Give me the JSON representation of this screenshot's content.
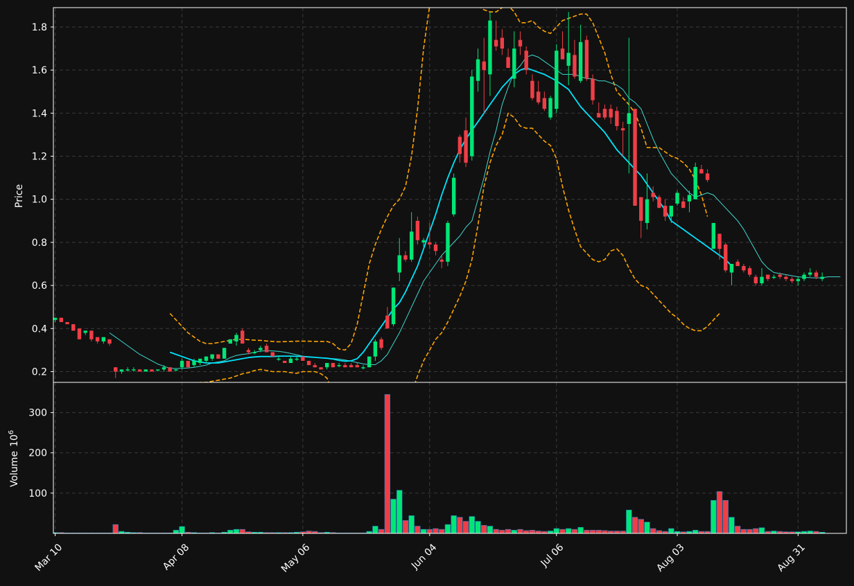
{
  "chart_data": {
    "type": "candlestick",
    "price_axis": {
      "label": "Price",
      "ticks": [
        0.2,
        0.4,
        0.6,
        0.8,
        1.0,
        1.2,
        1.4,
        1.6,
        1.8
      ],
      "ylim": [
        0.15,
        1.89
      ]
    },
    "volume_axis": {
      "label": "Volume",
      "exponent_label": "10",
      "exponent": "6",
      "ticks": [
        100,
        200,
        300
      ],
      "ylim": [
        0,
        375
      ]
    },
    "x_axis": {
      "ticks": [
        {
          "label": "Mar 10",
          "index": 0
        },
        {
          "label": "Apr 08",
          "index": 21
        },
        {
          "label": "May 06",
          "index": 41
        },
        {
          "label": "Jun 04",
          "index": 62
        },
        {
          "label": "Jul 06",
          "index": 83
        },
        {
          "label": "Aug 03",
          "index": 103
        },
        {
          "label": "Aug 31",
          "index": 123
        }
      ],
      "index_range": [
        -0.3,
        131
      ]
    },
    "grid": true,
    "colors": {
      "background": "#111111",
      "up": "#00e676",
      "down": "#ef3e47",
      "ma_fast": "#40d9d0",
      "ma_slow": "#00e5ff",
      "bands": "#ffa500",
      "grid": "#3a3a3a",
      "text": "#ffffff"
    },
    "candles": [
      [
        0.44,
        0.45,
        0.43,
        0.45,
        2
      ],
      [
        0.45,
        0.45,
        0.43,
        0.43,
        2
      ],
      [
        0.43,
        0.43,
        0.42,
        0.42,
        1
      ],
      [
        0.42,
        0.42,
        0.39,
        0.39,
        1
      ],
      [
        0.4,
        0.4,
        0.35,
        0.35,
        1
      ],
      [
        0.38,
        0.39,
        0.37,
        0.39,
        1
      ],
      [
        0.39,
        0.39,
        0.34,
        0.35,
        1
      ],
      [
        0.36,
        0.36,
        0.33,
        0.34,
        1
      ],
      [
        0.34,
        0.36,
        0.33,
        0.36,
        1
      ],
      [
        0.35,
        0.35,
        0.32,
        0.33,
        1
      ],
      [
        0.22,
        0.22,
        0.17,
        0.2,
        22
      ],
      [
        0.2,
        0.21,
        0.19,
        0.21,
        5
      ],
      [
        0.21,
        0.22,
        0.2,
        0.21,
        3
      ],
      [
        0.21,
        0.22,
        0.2,
        0.21,
        2
      ],
      [
        0.21,
        0.21,
        0.2,
        0.2,
        2
      ],
      [
        0.2,
        0.21,
        0.2,
        0.21,
        1
      ],
      [
        0.21,
        0.21,
        0.2,
        0.2,
        1
      ],
      [
        0.21,
        0.21,
        0.2,
        0.21,
        1
      ],
      [
        0.21,
        0.23,
        0.2,
        0.22,
        1
      ],
      [
        0.22,
        0.22,
        0.2,
        0.2,
        1
      ],
      [
        0.21,
        0.21,
        0.2,
        0.21,
        8
      ],
      [
        0.22,
        0.26,
        0.21,
        0.25,
        17
      ],
      [
        0.25,
        0.25,
        0.22,
        0.22,
        3
      ],
      [
        0.23,
        0.26,
        0.22,
        0.25,
        2
      ],
      [
        0.24,
        0.26,
        0.23,
        0.26,
        1
      ],
      [
        0.25,
        0.27,
        0.24,
        0.27,
        1
      ],
      [
        0.26,
        0.28,
        0.25,
        0.28,
        2
      ],
      [
        0.28,
        0.28,
        0.26,
        0.26,
        1
      ],
      [
        0.26,
        0.31,
        0.26,
        0.31,
        3
      ],
      [
        0.33,
        0.35,
        0.33,
        0.35,
        8
      ],
      [
        0.34,
        0.38,
        0.32,
        0.37,
        10
      ],
      [
        0.39,
        0.4,
        0.33,
        0.33,
        10
      ],
      [
        0.3,
        0.31,
        0.28,
        0.29,
        4
      ],
      [
        0.29,
        0.3,
        0.28,
        0.29,
        3
      ],
      [
        0.3,
        0.32,
        0.29,
        0.31,
        3
      ],
      [
        0.32,
        0.33,
        0.29,
        0.29,
        2
      ],
      [
        0.29,
        0.29,
        0.27,
        0.27,
        2
      ],
      [
        0.26,
        0.27,
        0.25,
        0.26,
        2
      ],
      [
        0.25,
        0.25,
        0.24,
        0.24,
        2
      ],
      [
        0.24,
        0.27,
        0.24,
        0.26,
        2
      ],
      [
        0.26,
        0.27,
        0.25,
        0.26,
        3
      ],
      [
        0.27,
        0.27,
        0.25,
        0.25,
        4
      ],
      [
        0.25,
        0.25,
        0.23,
        0.23,
        6
      ],
      [
        0.23,
        0.24,
        0.22,
        0.22,
        5
      ],
      [
        0.22,
        0.22,
        0.21,
        0.21,
        2
      ],
      [
        0.22,
        0.24,
        0.21,
        0.24,
        3
      ],
      [
        0.24,
        0.24,
        0.22,
        0.22,
        2
      ],
      [
        0.23,
        0.24,
        0.22,
        0.23,
        1
      ],
      [
        0.23,
        0.24,
        0.22,
        0.22,
        1
      ],
      [
        0.23,
        0.24,
        0.22,
        0.22,
        1
      ],
      [
        0.23,
        0.24,
        0.22,
        0.22,
        1
      ],
      [
        0.22,
        0.23,
        0.21,
        0.22,
        1
      ],
      [
        0.22,
        0.27,
        0.22,
        0.27,
        5
      ],
      [
        0.27,
        0.35,
        0.25,
        0.34,
        18
      ],
      [
        0.35,
        0.36,
        0.3,
        0.31,
        10
      ],
      [
        0.46,
        0.5,
        0.4,
        0.4,
        345
      ],
      [
        0.42,
        0.59,
        0.41,
        0.59,
        85
      ],
      [
        0.66,
        0.82,
        0.62,
        0.74,
        107
      ],
      [
        0.74,
        0.76,
        0.71,
        0.72,
        32
      ],
      [
        0.72,
        0.94,
        0.71,
        0.85,
        44
      ],
      [
        0.9,
        0.92,
        0.79,
        0.81,
        18
      ],
      [
        0.8,
        0.82,
        0.78,
        0.81,
        10
      ],
      [
        0.8,
        0.89,
        0.77,
        0.79,
        10
      ],
      [
        0.79,
        0.8,
        0.74,
        0.76,
        12
      ],
      [
        0.72,
        0.74,
        0.68,
        0.71,
        10
      ],
      [
        0.71,
        0.9,
        0.69,
        0.89,
        22
      ],
      [
        0.93,
        1.12,
        0.92,
        1.1,
        44
      ],
      [
        1.29,
        1.3,
        1.17,
        1.21,
        40
      ],
      [
        1.32,
        1.38,
        1.15,
        1.17,
        30
      ],
      [
        1.2,
        1.6,
        1.18,
        1.57,
        42
      ],
      [
        1.55,
        1.7,
        1.5,
        1.65,
        30
      ],
      [
        1.64,
        1.75,
        1.4,
        1.6,
        20
      ],
      [
        1.58,
        1.87,
        1.48,
        1.83,
        18
      ],
      [
        1.74,
        1.83,
        1.69,
        1.71,
        10
      ],
      [
        1.75,
        1.79,
        1.67,
        1.7,
        8
      ],
      [
        1.66,
        1.7,
        1.61,
        1.61,
        10
      ],
      [
        1.56,
        1.78,
        1.52,
        1.7,
        8
      ],
      [
        1.74,
        1.78,
        1.67,
        1.71,
        10
      ],
      [
        1.69,
        1.71,
        1.58,
        1.6,
        7
      ],
      [
        1.55,
        1.58,
        1.46,
        1.47,
        8
      ],
      [
        1.5,
        1.55,
        1.44,
        1.45,
        6
      ],
      [
        1.47,
        1.5,
        1.41,
        1.42,
        5
      ],
      [
        1.38,
        1.48,
        1.37,
        1.47,
        6
      ],
      [
        1.42,
        1.72,
        1.4,
        1.69,
        12
      ],
      [
        1.7,
        1.78,
        1.65,
        1.65,
        10
      ],
      [
        1.62,
        1.87,
        1.53,
        1.68,
        12
      ],
      [
        1.67,
        1.74,
        1.56,
        1.57,
        10
      ],
      [
        1.55,
        1.81,
        1.54,
        1.73,
        15
      ],
      [
        1.74,
        1.76,
        1.55,
        1.56,
        8
      ],
      [
        1.56,
        1.58,
        1.44,
        1.46,
        8
      ],
      [
        1.4,
        1.45,
        1.38,
        1.38,
        8
      ],
      [
        1.42,
        1.44,
        1.37,
        1.38,
        7
      ],
      [
        1.42,
        1.44,
        1.35,
        1.38,
        6
      ],
      [
        1.41,
        1.43,
        1.32,
        1.34,
        6
      ],
      [
        1.33,
        1.36,
        1.2,
        1.32,
        6
      ],
      [
        1.35,
        1.75,
        1.12,
        1.4,
        58
      ],
      [
        1.42,
        1.42,
        0.98,
        0.97,
        40
      ],
      [
        1.01,
        1.01,
        0.82,
        0.9,
        35
      ],
      [
        0.89,
        1.12,
        0.86,
        1.0,
        28
      ],
      [
        1.03,
        1.06,
        0.99,
        1.01,
        12
      ],
      [
        1.01,
        1.02,
        0.96,
        0.96,
        7
      ],
      [
        0.97,
        1.0,
        0.9,
        0.92,
        5
      ],
      [
        0.92,
        0.97,
        0.89,
        0.97,
        12
      ],
      [
        0.98,
        1.04,
        0.97,
        1.03,
        5
      ],
      [
        0.99,
        1.01,
        0.96,
        0.96,
        4
      ],
      [
        0.99,
        1.04,
        0.94,
        1.02,
        5
      ],
      [
        1.0,
        1.17,
        1.0,
        1.15,
        8
      ],
      [
        1.14,
        1.16,
        1.12,
        1.12,
        5
      ],
      [
        1.12,
        1.14,
        1.08,
        1.09,
        5
      ],
      [
        0.77,
        0.89,
        0.77,
        0.89,
        82
      ],
      [
        0.84,
        0.84,
        0.72,
        0.77,
        104
      ],
      [
        0.79,
        0.8,
        0.66,
        0.67,
        82
      ],
      [
        0.66,
        0.7,
        0.6,
        0.7,
        40
      ],
      [
        0.71,
        0.72,
        0.69,
        0.69,
        18
      ],
      [
        0.69,
        0.7,
        0.66,
        0.67,
        10
      ],
      [
        0.68,
        0.69,
        0.64,
        0.65,
        10
      ],
      [
        0.64,
        0.65,
        0.6,
        0.61,
        12
      ],
      [
        0.61,
        0.68,
        0.6,
        0.64,
        14
      ],
      [
        0.65,
        0.65,
        0.62,
        0.63,
        5
      ],
      [
        0.64,
        0.65,
        0.63,
        0.64,
        6
      ],
      [
        0.65,
        0.66,
        0.63,
        0.64,
        5
      ],
      [
        0.64,
        0.65,
        0.62,
        0.63,
        4
      ],
      [
        0.63,
        0.64,
        0.61,
        0.62,
        4
      ],
      [
        0.62,
        0.64,
        0.6,
        0.63,
        4
      ],
      [
        0.63,
        0.66,
        0.62,
        0.65,
        5
      ],
      [
        0.65,
        0.68,
        0.64,
        0.66,
        6
      ],
      [
        0.66,
        0.67,
        0.63,
        0.64,
        5
      ],
      [
        0.63,
        0.66,
        0.62,
        0.64,
        3
      ]
    ],
    "overlays": {
      "ma_fast": {
        "start_index": 9,
        "values": [
          0.38,
          0.36,
          0.34,
          0.32,
          0.3,
          0.28,
          0.265,
          0.25,
          0.235,
          0.225,
          0.215,
          0.214,
          0.215,
          0.217,
          0.22,
          0.225,
          0.23,
          0.24,
          0.245,
          0.25,
          0.265,
          0.275,
          0.28,
          0.283,
          0.29,
          0.295,
          0.297,
          0.296,
          0.294,
          0.29,
          0.284,
          0.278,
          0.272,
          0.268,
          0.266,
          0.264,
          0.262,
          0.26,
          0.258,
          0.254,
          0.248,
          0.242,
          0.236,
          0.232,
          0.232,
          0.25,
          0.28,
          0.33,
          0.38,
          0.44,
          0.5,
          0.56,
          0.62,
          0.66,
          0.7,
          0.74,
          0.77,
          0.8,
          0.83,
          0.87,
          0.9,
          1.0,
          1.1,
          1.22,
          1.32,
          1.44,
          1.52,
          1.59,
          1.62,
          1.66,
          1.67,
          1.66,
          1.64,
          1.62,
          1.6,
          1.58,
          1.58,
          1.58,
          1.57,
          1.56,
          1.56,
          1.55,
          1.55,
          1.54,
          1.53,
          1.51,
          1.47,
          1.45,
          1.42,
          1.35,
          1.28,
          1.22,
          1.17,
          1.12,
          1.09,
          1.06,
          1.03,
          1.01,
          1.02,
          1.03,
          1.02,
          0.99,
          0.96,
          0.93,
          0.9,
          0.86,
          0.81,
          0.76,
          0.71,
          0.68,
          0.66,
          0.655,
          0.65,
          0.645,
          0.64,
          0.638,
          0.636,
          0.635,
          0.636,
          0.64,
          0.64,
          0.64
        ]
      },
      "ma_slow": {
        "start_index": 19,
        "values": [
          0.29,
          0.28,
          0.27,
          0.26,
          0.25,
          0.245,
          0.24,
          0.24,
          0.24,
          0.245,
          0.25,
          0.255,
          0.26,
          0.265,
          0.268,
          0.27,
          0.27,
          0.27,
          0.272,
          0.272,
          0.272,
          0.271,
          0.27,
          0.268,
          0.266,
          0.264,
          0.262,
          0.258,
          0.252,
          0.248,
          0.25,
          0.26,
          0.29,
          0.33,
          0.37,
          0.41,
          0.45,
          0.49,
          0.52,
          0.57,
          0.63,
          0.69,
          0.77,
          0.85,
          0.93,
          1.02,
          1.1,
          1.17,
          1.23,
          1.28,
          1.32,
          1.36,
          1.4,
          1.44,
          1.48,
          1.52,
          1.55,
          1.58,
          1.6,
          1.61,
          1.6,
          1.59,
          1.58,
          1.565,
          1.55,
          1.53,
          1.51,
          1.47,
          1.43,
          1.4,
          1.37,
          1.34,
          1.31,
          1.27,
          1.23,
          1.2,
          1.17,
          1.14,
          1.11,
          1.07,
          1.03,
          0.99,
          0.95,
          0.9,
          0.88,
          0.86,
          0.84,
          0.82,
          0.8,
          0.78,
          0.76,
          0.74,
          0.72,
          0.69
        ]
      },
      "band_upper": {
        "start_index": 19,
        "values": [
          0.47,
          0.44,
          0.41,
          0.38,
          0.36,
          0.34,
          0.33,
          0.33,
          0.335,
          0.34,
          0.345,
          0.35,
          0.35,
          0.348,
          0.346,
          0.345,
          0.342,
          0.34,
          0.338,
          0.339,
          0.34,
          0.341,
          0.341,
          0.341,
          0.34,
          0.34,
          0.34,
          0.33,
          0.305,
          0.3,
          0.33,
          0.42,
          0.56,
          0.7,
          0.79,
          0.86,
          0.92,
          0.97,
          1.0,
          1.06,
          1.2,
          1.42,
          1.7,
          1.9,
          2.0,
          2.05,
          2.05,
          2.04,
          2.02,
          1.97,
          1.92,
          1.9,
          1.88,
          1.87,
          1.87,
          1.89,
          1.9,
          1.87,
          1.82,
          1.82,
          1.83,
          1.8,
          1.78,
          1.77,
          1.8,
          1.83,
          1.84,
          1.85,
          1.86,
          1.86,
          1.82,
          1.75,
          1.68,
          1.58,
          1.5,
          1.47,
          1.44,
          1.4,
          1.33,
          1.24,
          1.24,
          1.24,
          1.22,
          1.2,
          1.19,
          1.17,
          1.14,
          1.09,
          1.02,
          0.92
        ]
      },
      "band_lower": {
        "start_index": 19,
        "values": [
          0.08,
          0.09,
          0.1,
          0.12,
          0.14,
          0.15,
          0.15,
          0.155,
          0.16,
          0.165,
          0.17,
          0.18,
          0.19,
          0.195,
          0.205,
          0.21,
          0.205,
          0.2,
          0.2,
          0.2,
          0.195,
          0.192,
          0.2,
          0.2,
          0.2,
          0.19,
          0.17,
          0.1,
          0.0,
          -0.1,
          -0.2,
          -0.28,
          -0.31,
          -0.3,
          -0.26,
          -0.21,
          -0.15,
          -0.09,
          -0.03,
          0.04,
          0.1,
          0.18,
          0.25,
          0.3,
          0.35,
          0.38,
          0.43,
          0.49,
          0.55,
          0.62,
          0.72,
          0.88,
          1.06,
          1.17,
          1.25,
          1.3,
          1.4,
          1.38,
          1.34,
          1.33,
          1.33,
          1.3,
          1.27,
          1.25,
          1.19,
          1.06,
          0.95,
          0.86,
          0.78,
          0.75,
          0.72,
          0.71,
          0.72,
          0.76,
          0.77,
          0.74,
          0.68,
          0.63,
          0.6,
          0.59,
          0.56,
          0.53,
          0.5,
          0.47,
          0.45,
          0.42,
          0.4,
          0.39,
          0.39,
          0.41,
          0.44,
          0.47
        ]
      }
    }
  }
}
